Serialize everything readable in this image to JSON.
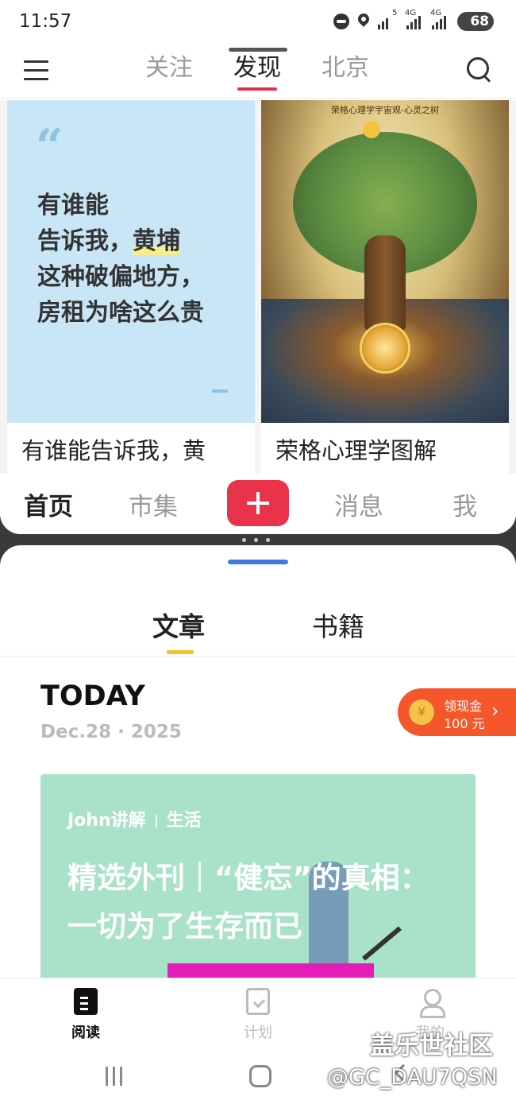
{
  "status_bar": {
    "time": "11:57",
    "battery": "68",
    "net1": "4G",
    "net2": "4G",
    "wifi_label": "5"
  },
  "top_app": {
    "tabs": [
      "关注",
      "发现",
      "北京"
    ],
    "active_tab": "发现",
    "cards": [
      {
        "quote_mark": "“",
        "quote_lines": [
          "有谁能",
          "告诉我，",
          "黄埔",
          "这种破偏地方，",
          "房租为啥这么贵"
        ],
        "title": "有谁能告诉我，黄"
      },
      {
        "image_title": "荣格心理学宇宙观-心灵之树",
        "title": "荣格心理学图解"
      }
    ],
    "bottom_nav": [
      "首页",
      "市集",
      "消息",
      "我"
    ]
  },
  "bottom_app": {
    "tabs": [
      "文章",
      "书籍"
    ],
    "today_label": "TODAY",
    "date": "Dec.28 · 2025",
    "cash_badge": {
      "line1": "领现金",
      "line2": "100 元",
      "coin": "¥",
      "arrow": "›"
    },
    "article": {
      "author": "John讲解",
      "category": "生活",
      "title": "精选外刊｜“健忘”的真相：一切为了生存而已"
    },
    "tabbar": [
      "阅读",
      "计划",
      "我的"
    ]
  },
  "watermark": {
    "line1": "盖乐世社区",
    "line2": "@GC_DAU7QSN"
  },
  "colors": {
    "accent_red": "#e8334a",
    "quote_bg": "#c9e6f7",
    "article_bg": "#a9e1c9",
    "cash_orange": "#f5562a",
    "tab_yellow": "#f2c12e"
  }
}
